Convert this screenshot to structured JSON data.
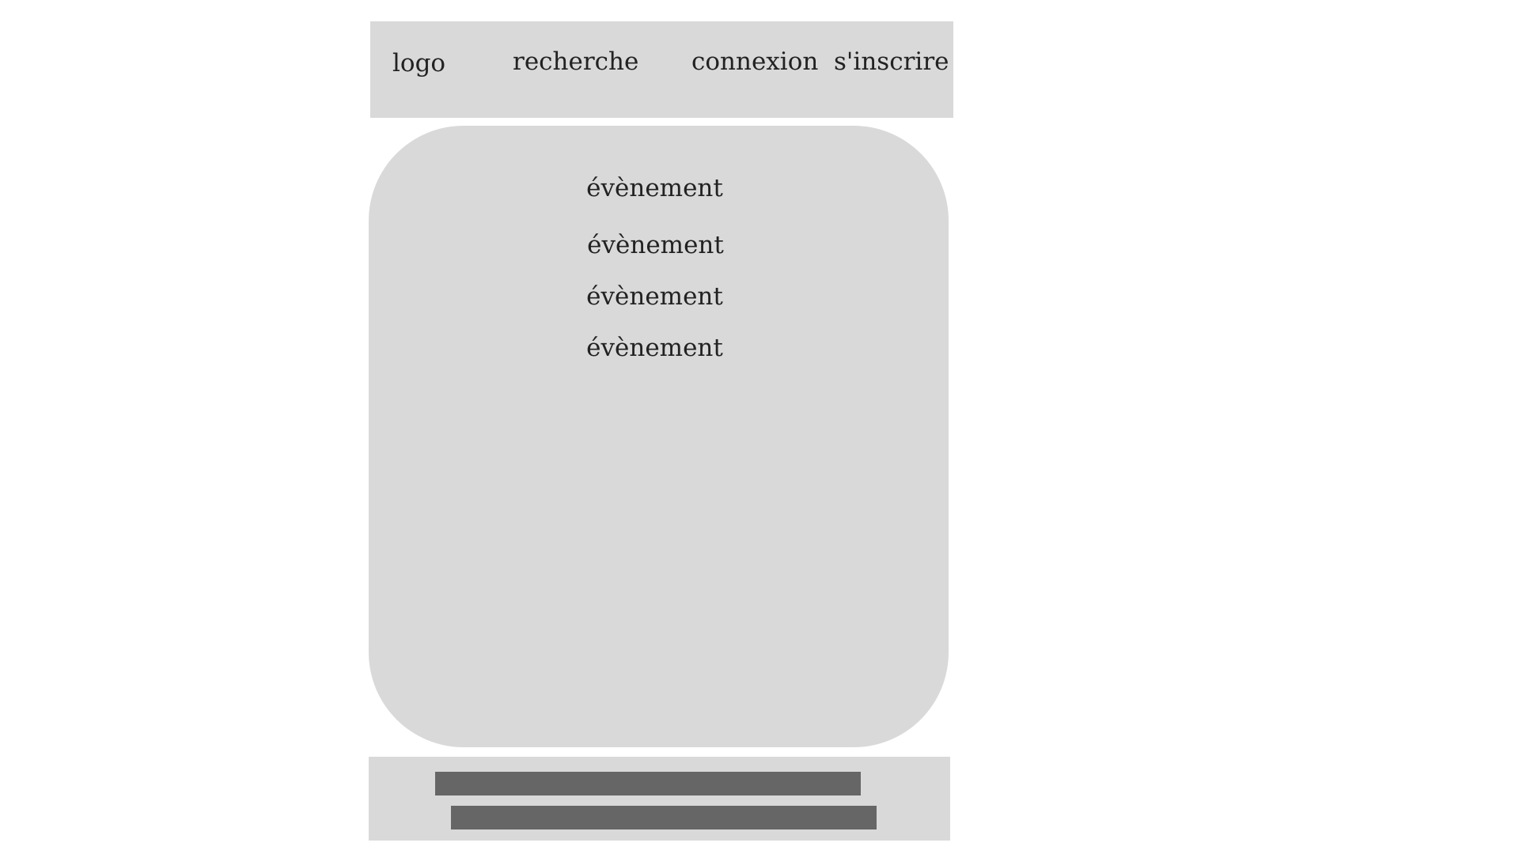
{
  "header": {
    "logo": "logo",
    "search": "recherche",
    "login": "connexion",
    "signup": "s'inscrire"
  },
  "events": [
    {
      "label": "évènement"
    },
    {
      "label": "évènement"
    },
    {
      "label": "évènement"
    },
    {
      "label": "évènement"
    }
  ],
  "colors": {
    "panel": "#d9d9d9",
    "footer_bar": "#666666",
    "text": "#222222",
    "background": "#ffffff"
  }
}
